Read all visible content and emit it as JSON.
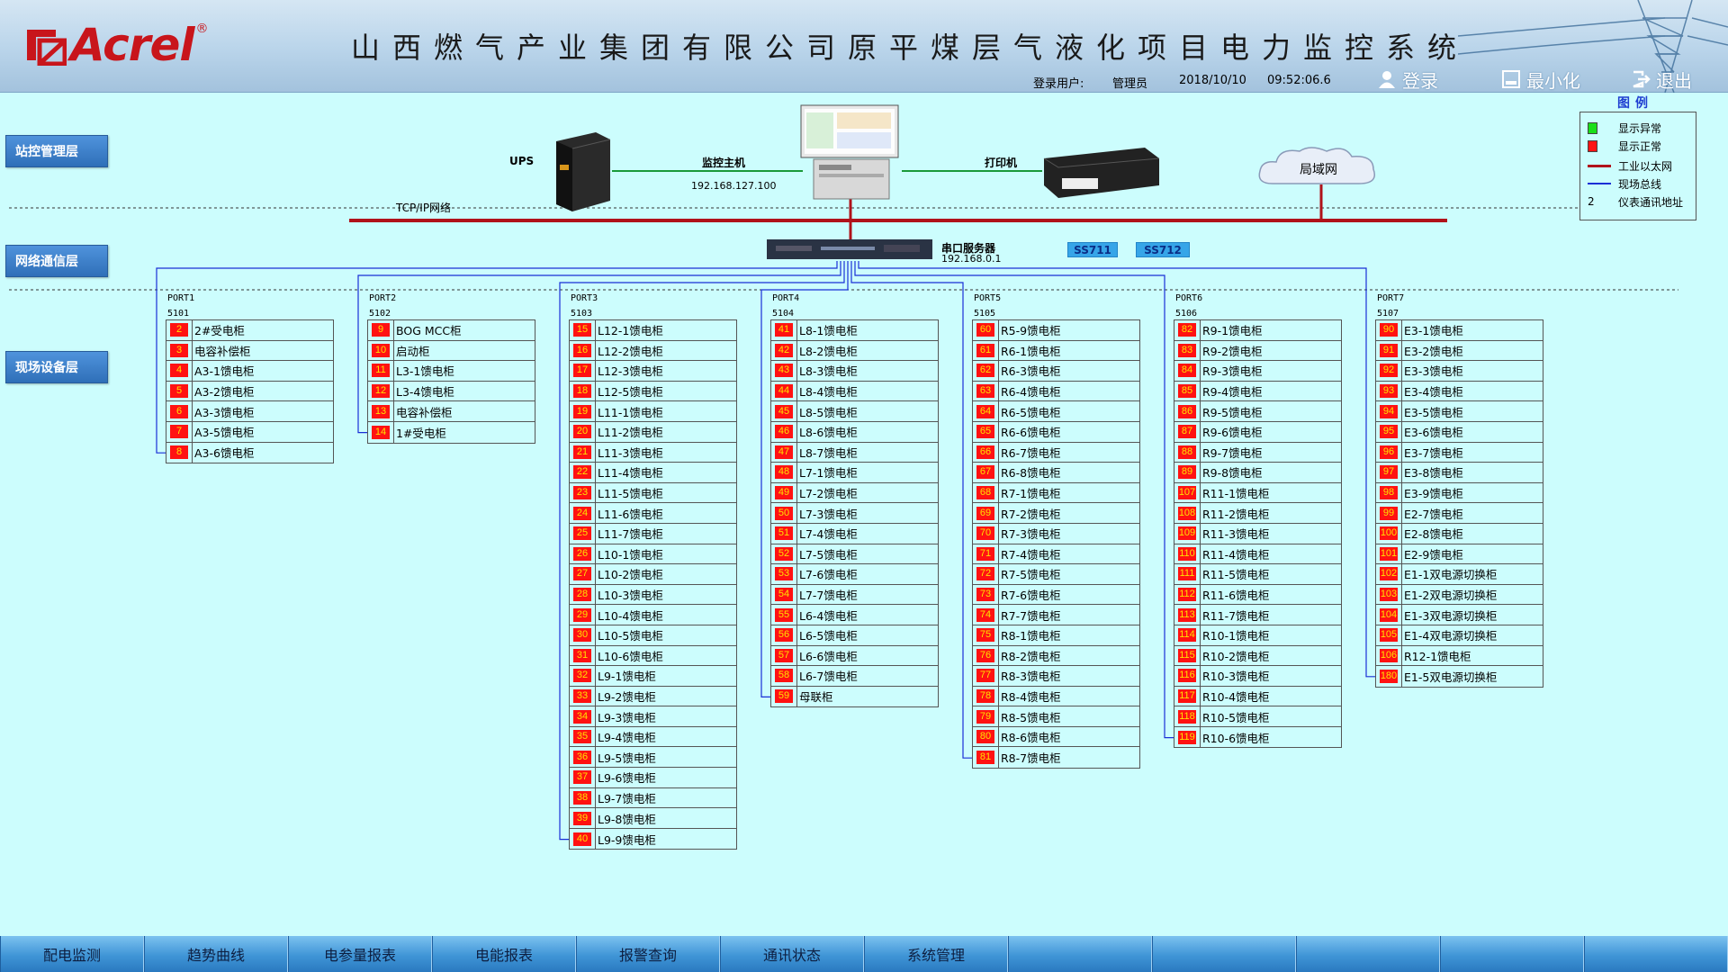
{
  "header": {
    "logo_text": "Acrel",
    "title": "山西燃气产业集团有限公司原平煤层气液化项目电力监控系统",
    "login_user_label": "登录用户:",
    "login_user": "管理员",
    "date": "2018/10/10",
    "time": "09:52:06.6",
    "login_button": "登录",
    "minimize_button": "最小化",
    "exit_button": "退出"
  },
  "layers": {
    "station": "站控管理层",
    "network": "网络通信层",
    "field": "现场设备层"
  },
  "devices": {
    "ups": "UPS",
    "host": "监控主机",
    "host_ip": "192.168.127.100",
    "printer": "打印机",
    "lan": "局域网",
    "tcpip": "TCP/IP网络",
    "serial_server": "串口服务器",
    "serial_ip": "192.168.0.1",
    "ss711": "SS711",
    "ss712": "SS712"
  },
  "legend": {
    "title": "图例",
    "items": [
      {
        "label": "显示异常",
        "symbol": "green-square",
        "color": "#1adf1a"
      },
      {
        "label": "显示正常",
        "symbol": "red-square",
        "color": "#ff1212"
      },
      {
        "label": "工业以太网",
        "symbol": "red-line",
        "color": "#b0121a"
      },
      {
        "label": "现场总线",
        "symbol": "blue-line",
        "color": "#1a2fd6"
      },
      {
        "label": "仪表通讯地址",
        "symbol": "number",
        "number": "2"
      }
    ]
  },
  "ports": [
    {
      "name": "PORT1",
      "code": "5101",
      "rows": [
        {
          "addr": "2",
          "name": "2#受电柜"
        },
        {
          "addr": "3",
          "name": "电容补偿柜"
        },
        {
          "addr": "4",
          "name": "A3-1馈电柜"
        },
        {
          "addr": "5",
          "name": "A3-2馈电柜"
        },
        {
          "addr": "6",
          "name": "A3-3馈电柜"
        },
        {
          "addr": "7",
          "name": "A3-5馈电柜"
        },
        {
          "addr": "8",
          "name": "A3-6馈电柜"
        }
      ]
    },
    {
      "name": "PORT2",
      "code": "5102",
      "rows": [
        {
          "addr": "9",
          "name": "BOG MCC柜"
        },
        {
          "addr": "10",
          "name": "启动柜"
        },
        {
          "addr": "11",
          "name": "L3-1馈电柜"
        },
        {
          "addr": "12",
          "name": "L3-4馈电柜"
        },
        {
          "addr": "13",
          "name": "电容补偿柜"
        },
        {
          "addr": "14",
          "name": "1#受电柜"
        }
      ]
    },
    {
      "name": "PORT3",
      "code": "5103",
      "rows": [
        {
          "addr": "15",
          "name": "L12-1馈电柜"
        },
        {
          "addr": "16",
          "name": "L12-2馈电柜"
        },
        {
          "addr": "17",
          "name": "L12-3馈电柜"
        },
        {
          "addr": "18",
          "name": "L12-5馈电柜"
        },
        {
          "addr": "19",
          "name": "L11-1馈电柜"
        },
        {
          "addr": "20",
          "name": "L11-2馈电柜"
        },
        {
          "addr": "21",
          "name": "L11-3馈电柜"
        },
        {
          "addr": "22",
          "name": "L11-4馈电柜"
        },
        {
          "addr": "23",
          "name": "L11-5馈电柜"
        },
        {
          "addr": "24",
          "name": "L11-6馈电柜"
        },
        {
          "addr": "25",
          "name": "L11-7馈电柜"
        },
        {
          "addr": "26",
          "name": "L10-1馈电柜"
        },
        {
          "addr": "27",
          "name": "L10-2馈电柜"
        },
        {
          "addr": "28",
          "name": "L10-3馈电柜"
        },
        {
          "addr": "29",
          "name": "L10-4馈电柜"
        },
        {
          "addr": "30",
          "name": "L10-5馈电柜"
        },
        {
          "addr": "31",
          "name": "L10-6馈电柜"
        },
        {
          "addr": "32",
          "name": "L9-1馈电柜"
        },
        {
          "addr": "33",
          "name": "L9-2馈电柜"
        },
        {
          "addr": "34",
          "name": "L9-3馈电柜"
        },
        {
          "addr": "35",
          "name": "L9-4馈电柜"
        },
        {
          "addr": "36",
          "name": "L9-5馈电柜"
        },
        {
          "addr": "37",
          "name": "L9-6馈电柜"
        },
        {
          "addr": "38",
          "name": "L9-7馈电柜"
        },
        {
          "addr": "39",
          "name": "L9-8馈电柜"
        },
        {
          "addr": "40",
          "name": "L9-9馈电柜"
        }
      ]
    },
    {
      "name": "PORT4",
      "code": "5104",
      "rows": [
        {
          "addr": "41",
          "name": "L8-1馈电柜"
        },
        {
          "addr": "42",
          "name": "L8-2馈电柜"
        },
        {
          "addr": "43",
          "name": "L8-3馈电柜"
        },
        {
          "addr": "44",
          "name": "L8-4馈电柜"
        },
        {
          "addr": "45",
          "name": "L8-5馈电柜"
        },
        {
          "addr": "46",
          "name": "L8-6馈电柜"
        },
        {
          "addr": "47",
          "name": "L8-7馈电柜"
        },
        {
          "addr": "48",
          "name": "L7-1馈电柜"
        },
        {
          "addr": "49",
          "name": "L7-2馈电柜"
        },
        {
          "addr": "50",
          "name": "L7-3馈电柜"
        },
        {
          "addr": "51",
          "name": "L7-4馈电柜"
        },
        {
          "addr": "52",
          "name": "L7-5馈电柜"
        },
        {
          "addr": "53",
          "name": "L7-6馈电柜"
        },
        {
          "addr": "54",
          "name": "L7-7馈电柜"
        },
        {
          "addr": "55",
          "name": "L6-4馈电柜"
        },
        {
          "addr": "56",
          "name": "L6-5馈电柜"
        },
        {
          "addr": "57",
          "name": "L6-6馈电柜"
        },
        {
          "addr": "58",
          "name": "L6-7馈电柜"
        },
        {
          "addr": "59",
          "name": "母联柜"
        }
      ]
    },
    {
      "name": "PORT5",
      "code": "5105",
      "rows": [
        {
          "addr": "60",
          "name": "R5-9馈电柜"
        },
        {
          "addr": "61",
          "name": "R6-1馈电柜"
        },
        {
          "addr": "62",
          "name": "R6-3馈电柜"
        },
        {
          "addr": "63",
          "name": "R6-4馈电柜"
        },
        {
          "addr": "64",
          "name": "R6-5馈电柜"
        },
        {
          "addr": "65",
          "name": "R6-6馈电柜"
        },
        {
          "addr": "66",
          "name": "R6-7馈电柜"
        },
        {
          "addr": "67",
          "name": "R6-8馈电柜"
        },
        {
          "addr": "68",
          "name": "R7-1馈电柜"
        },
        {
          "addr": "69",
          "name": "R7-2馈电柜"
        },
        {
          "addr": "70",
          "name": "R7-3馈电柜"
        },
        {
          "addr": "71",
          "name": "R7-4馈电柜"
        },
        {
          "addr": "72",
          "name": "R7-5馈电柜"
        },
        {
          "addr": "73",
          "name": "R7-6馈电柜"
        },
        {
          "addr": "74",
          "name": "R7-7馈电柜"
        },
        {
          "addr": "75",
          "name": "R8-1馈电柜"
        },
        {
          "addr": "76",
          "name": "R8-2馈电柜"
        },
        {
          "addr": "77",
          "name": "R8-3馈电柜"
        },
        {
          "addr": "78",
          "name": "R8-4馈电柜"
        },
        {
          "addr": "79",
          "name": "R8-5馈电柜"
        },
        {
          "addr": "80",
          "name": "R8-6馈电柜"
        },
        {
          "addr": "81",
          "name": "R8-7馈电柜"
        }
      ]
    },
    {
      "name": "PORT6",
      "code": "5106",
      "rows": [
        {
          "addr": "82",
          "name": "R9-1馈电柜"
        },
        {
          "addr": "83",
          "name": "R9-2馈电柜"
        },
        {
          "addr": "84",
          "name": "R9-3馈电柜"
        },
        {
          "addr": "85",
          "name": "R9-4馈电柜"
        },
        {
          "addr": "86",
          "name": "R9-5馈电柜"
        },
        {
          "addr": "87",
          "name": "R9-6馈电柜"
        },
        {
          "addr": "88",
          "name": "R9-7馈电柜"
        },
        {
          "addr": "89",
          "name": "R9-8馈电柜"
        },
        {
          "addr": "107",
          "name": "R11-1馈电柜"
        },
        {
          "addr": "108",
          "name": "R11-2馈电柜"
        },
        {
          "addr": "109",
          "name": "R11-3馈电柜"
        },
        {
          "addr": "110",
          "name": "R11-4馈电柜"
        },
        {
          "addr": "111",
          "name": "R11-5馈电柜"
        },
        {
          "addr": "112",
          "name": "R11-6馈电柜"
        },
        {
          "addr": "113",
          "name": "R11-7馈电柜"
        },
        {
          "addr": "114",
          "name": "R10-1馈电柜"
        },
        {
          "addr": "115",
          "name": "R10-2馈电柜"
        },
        {
          "addr": "116",
          "name": "R10-3馈电柜"
        },
        {
          "addr": "117",
          "name": "R10-4馈电柜"
        },
        {
          "addr": "118",
          "name": "R10-5馈电柜"
        },
        {
          "addr": "119",
          "name": "R10-6馈电柜"
        }
      ]
    },
    {
      "name": "PORT7",
      "code": "5107",
      "rows": [
        {
          "addr": "90",
          "name": "E3-1馈电柜"
        },
        {
          "addr": "91",
          "name": "E3-2馈电柜"
        },
        {
          "addr": "92",
          "name": "E3-3馈电柜"
        },
        {
          "addr": "93",
          "name": "E3-4馈电柜"
        },
        {
          "addr": "94",
          "name": "E3-5馈电柜"
        },
        {
          "addr": "95",
          "name": "E3-6馈电柜"
        },
        {
          "addr": "96",
          "name": "E3-7馈电柜"
        },
        {
          "addr": "97",
          "name": "E3-8馈电柜"
        },
        {
          "addr": "98",
          "name": "E3-9馈电柜"
        },
        {
          "addr": "99",
          "name": "E2-7馈电柜"
        },
        {
          "addr": "100",
          "name": "E2-8馈电柜"
        },
        {
          "addr": "101",
          "name": "E2-9馈电柜"
        },
        {
          "addr": "102",
          "name": "E1-1双电源切换柜"
        },
        {
          "addr": "103",
          "name": "E1-2双电源切换柜"
        },
        {
          "addr": "104",
          "name": "E1-3双电源切换柜"
        },
        {
          "addr": "105",
          "name": "E1-4双电源切换柜"
        },
        {
          "addr": "106",
          "name": "R12-1馈电柜"
        },
        {
          "addr": "180",
          "name": "E1-5双电源切换柜"
        }
      ]
    }
  ],
  "bottom_nav": [
    "配电监测",
    "趋势曲线",
    "电参量报表",
    "电能报表",
    "报警查询",
    "通讯状态",
    "系统管理",
    "",
    "",
    "",
    "",
    ""
  ]
}
